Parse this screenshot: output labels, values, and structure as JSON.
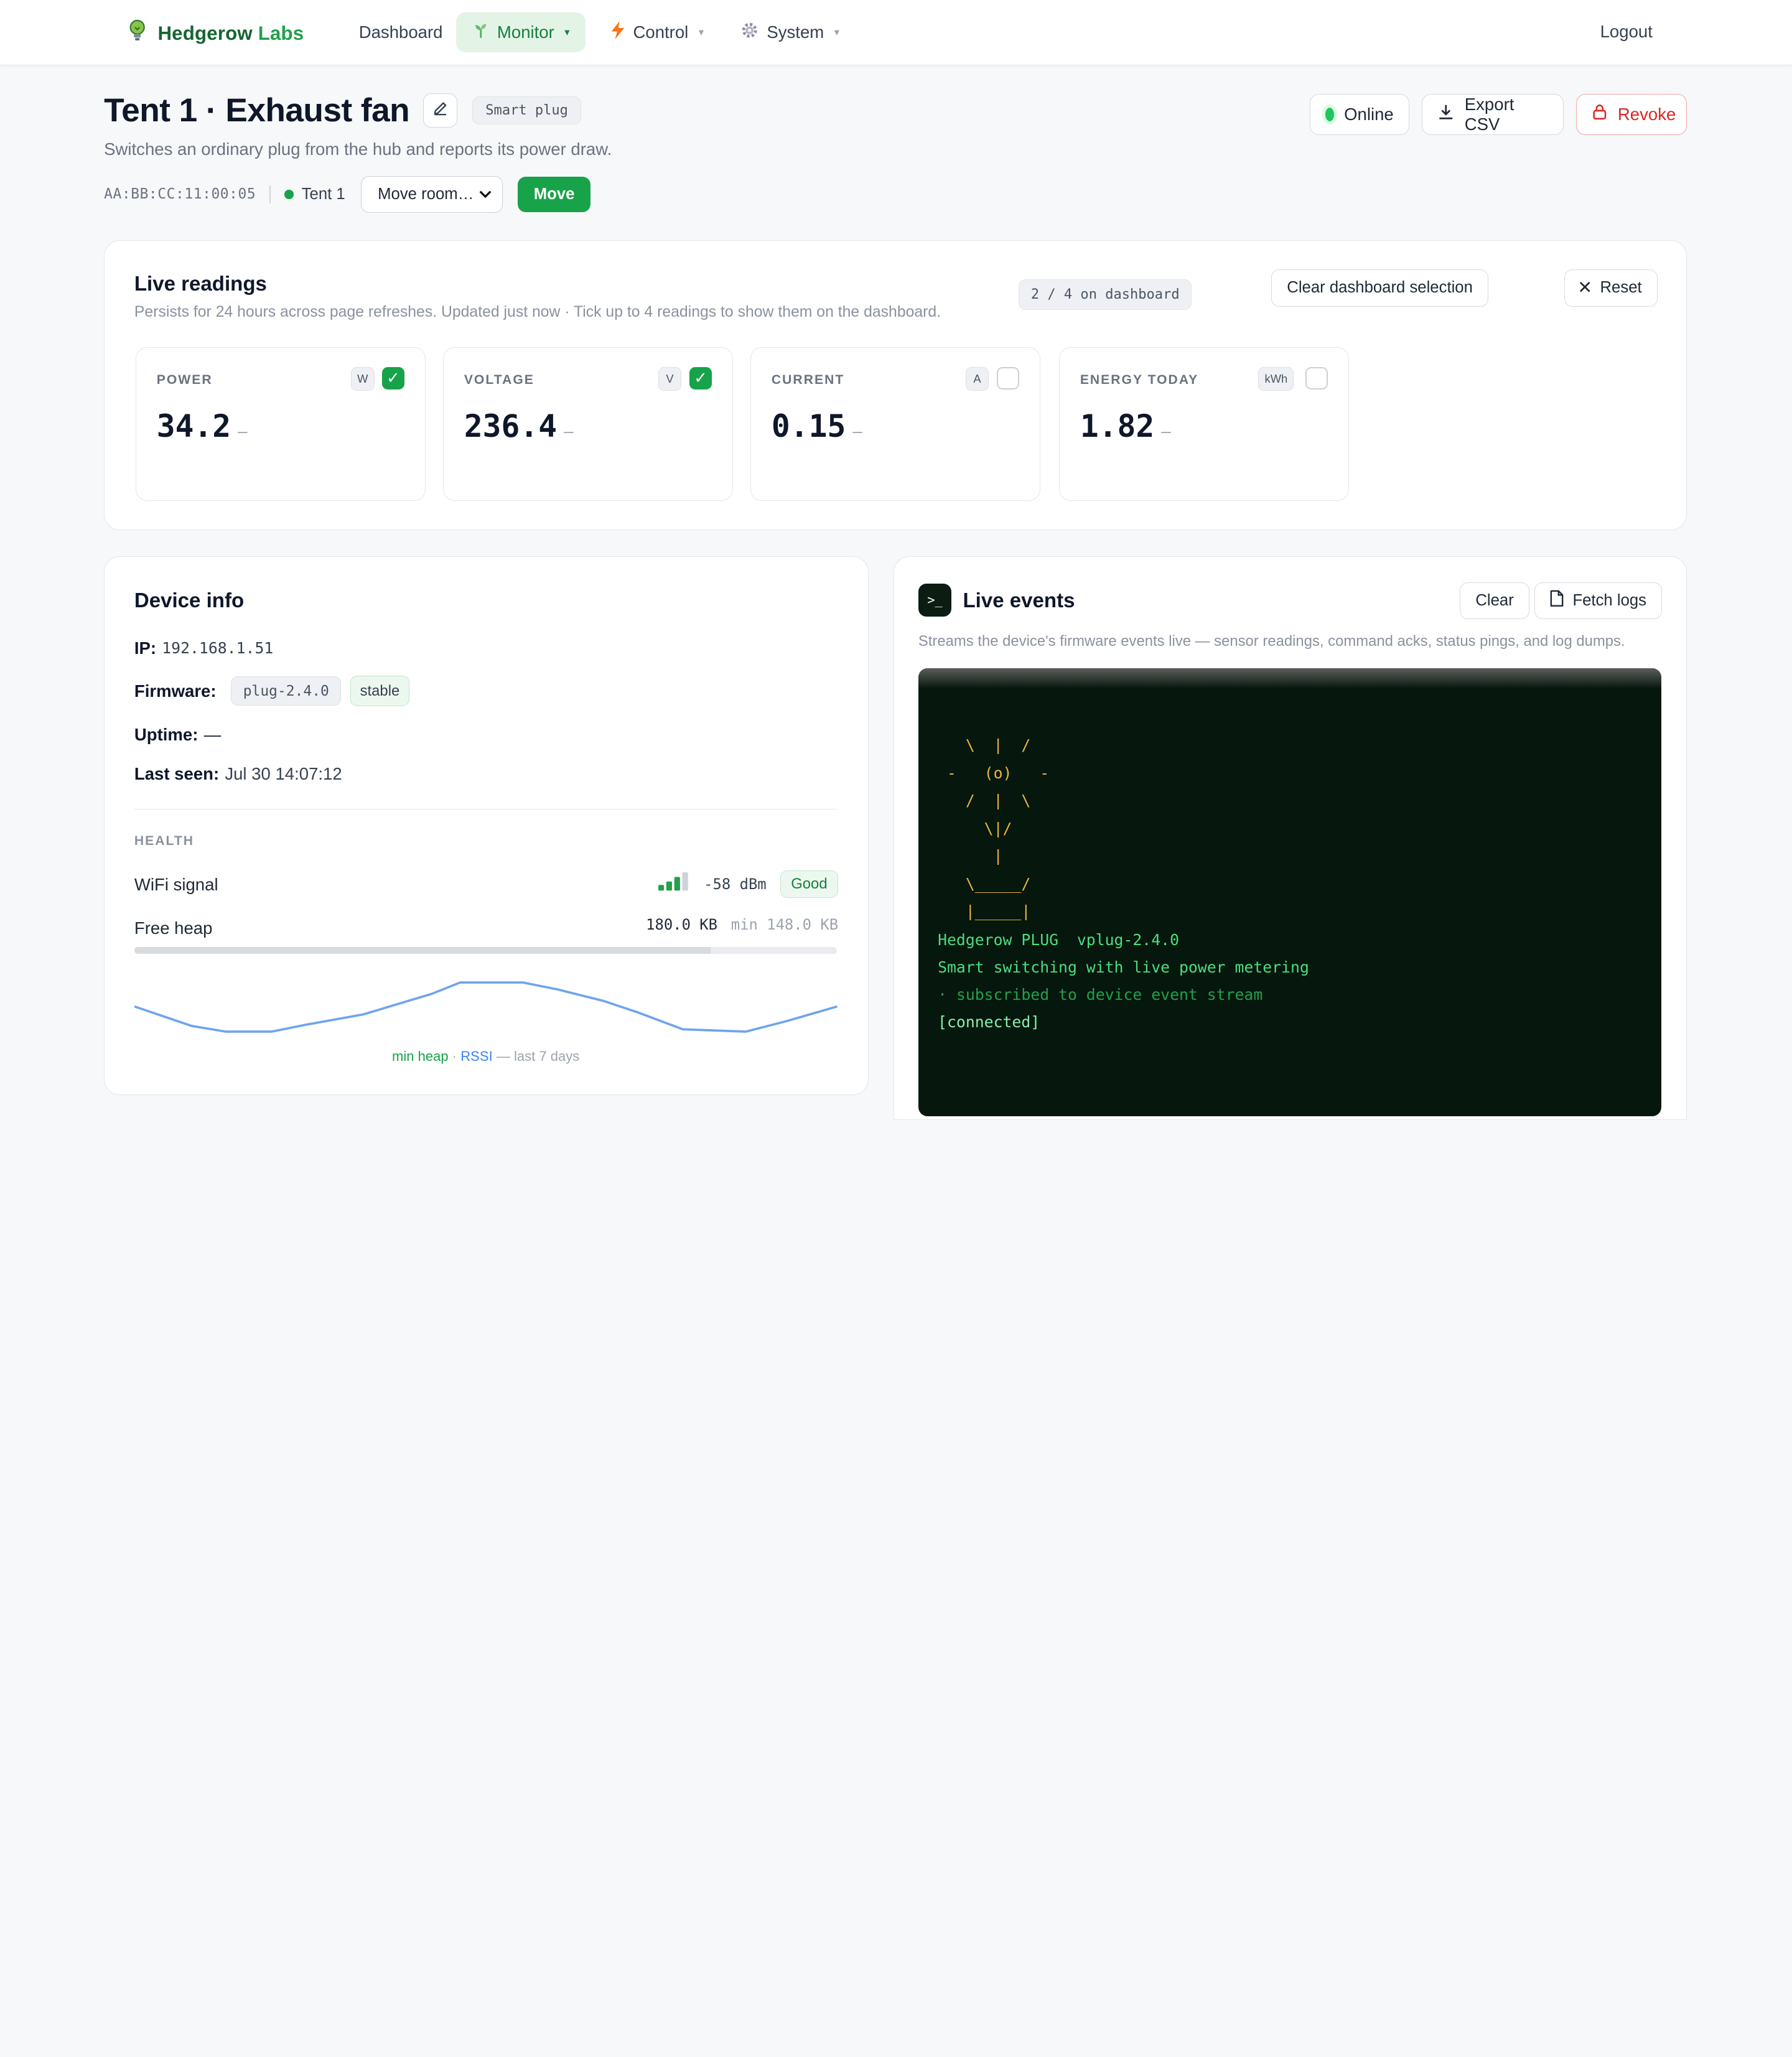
{
  "nav": {
    "brand_first": "Hedgerow",
    "brand_second": "Labs",
    "items": [
      {
        "label": "Dashboard"
      },
      {
        "label": "Monitor",
        "caret": "▾"
      },
      {
        "label": "Control",
        "caret": "▾"
      },
      {
        "label": "System",
        "caret": "▾"
      }
    ],
    "logout": "Logout"
  },
  "header": {
    "title": "Tent 1 · Exhaust fan",
    "type_badge": "Smart plug",
    "subtitle": "Switches an ordinary plug from the hub and reports its power draw.",
    "mac": "AA:BB:CC:11:00:05",
    "room": "Tent 1",
    "move_select_value": "Move room…",
    "move_button": "Move",
    "status": "Online",
    "export_button": "Export CSV",
    "revoke_button": "Revoke"
  },
  "live_readings": {
    "title": "Live readings",
    "description": "Persists for 24 hours across page refreshes. Updated just now · Tick up to 4 readings to show them on the dashboard.",
    "dashboard_count": "2 / 4 on dashboard",
    "clear_button": "Clear dashboard selection",
    "reset_button": "Reset",
    "tiles": [
      {
        "label": "POWER",
        "unit": "W",
        "value": "34.2",
        "trend": "–",
        "checked": true
      },
      {
        "label": "VOLTAGE",
        "unit": "V",
        "value": "236.4",
        "trend": "–",
        "checked": true
      },
      {
        "label": "CURRENT",
        "unit": "A",
        "value": "0.15",
        "trend": "–",
        "checked": false
      },
      {
        "label": "ENERGY TODAY",
        "unit": "kWh",
        "value": "1.82",
        "trend": "–",
        "checked": false
      }
    ]
  },
  "device_info": {
    "title": "Device info",
    "ip_label": "IP:",
    "ip": "192.168.1.51",
    "firmware_label": "Firmware:",
    "firmware": "plug-2.4.0",
    "firmware_channel": "stable",
    "uptime_label": "Uptime:",
    "uptime": "—",
    "last_seen_label": "Last seen:",
    "last_seen": "Jul 30 14:07:12",
    "health_label": "HEALTH",
    "wifi_label": "WiFi signal",
    "wifi_dbm": "-58 dBm",
    "wifi_quality": "Good",
    "wifi_bars_lit": 3,
    "wifi_bars_total": 4,
    "heap_label": "Free heap",
    "heap_value": "180.0 KB",
    "heap_min": "min 148.0 KB",
    "legend_heap": "min heap",
    "legend_sep": "·",
    "legend_rssi": "RSSI",
    "legend_period": "— last 7 days",
    "colors": {
      "heap": "#16a34a",
      "rssi": "#3b82f6",
      "line": "#6fa4ef"
    }
  },
  "events": {
    "title": "Live events",
    "clear_button": "Clear",
    "fetch_button": "Fetch logs",
    "description": "Streams the device's firmware events live — sensor readings, command acks, status pings, and log dumps.",
    "ascii_art": "   \\  |  /\n -   (o)   -\n   /  |  \\\n     \\|/\n      |\n   \\_____/\n   |_____|",
    "lines": [
      {
        "text": "Hedgerow PLUG  vplug-2.4.0",
        "color": "#4ade80"
      },
      {
        "text": "Smart switching with live power metering",
        "color": "#4ade80"
      },
      {
        "text": "· subscribed to device event stream",
        "color": "#22a04b"
      },
      {
        "text": "[connected]",
        "color": "#86efac"
      }
    ]
  }
}
